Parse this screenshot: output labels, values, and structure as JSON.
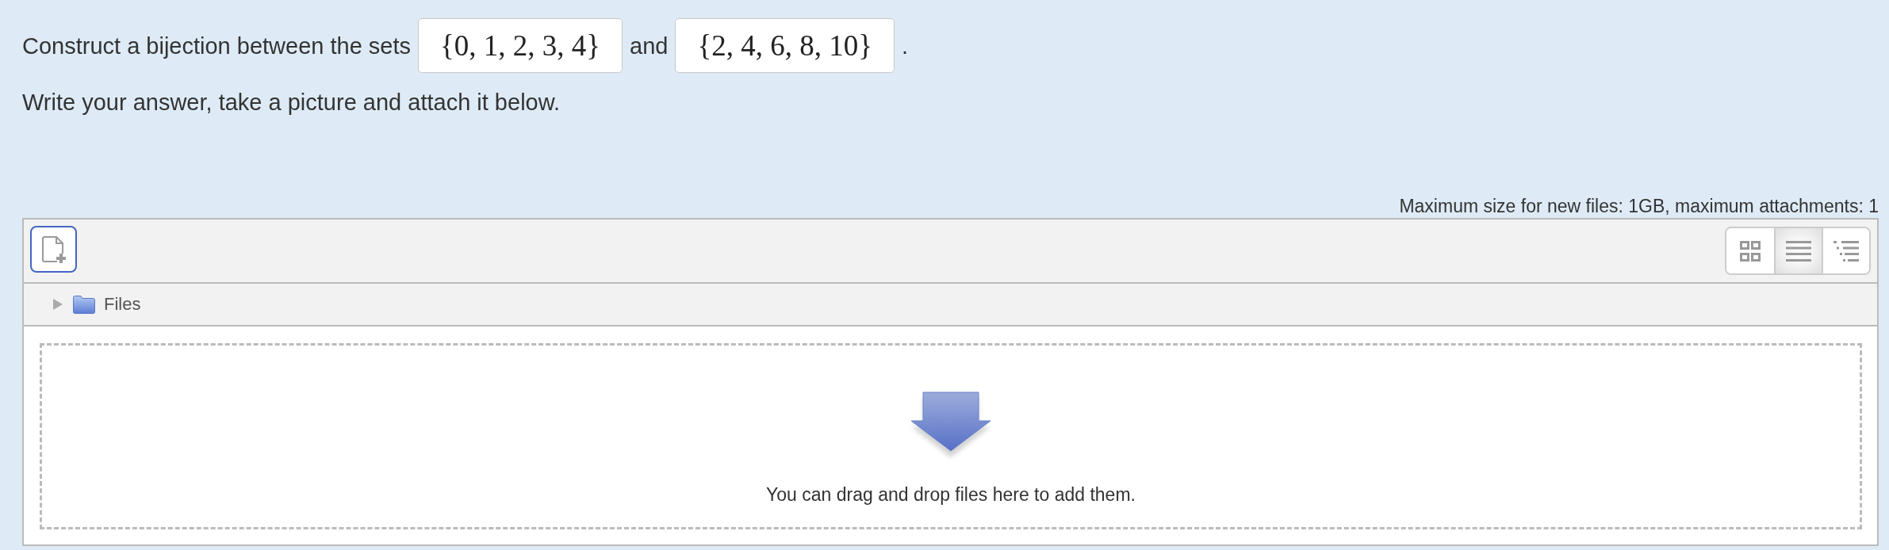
{
  "question": {
    "segments": [
      {
        "kind": "text",
        "text": "Construct a bijection between the sets"
      },
      {
        "kind": "math",
        "text": "{0, 1, 2, 3, 4}"
      },
      {
        "kind": "text",
        "text": "and"
      },
      {
        "kind": "math",
        "text": "{2, 4, 6, 8, 10}"
      },
      {
        "kind": "text",
        "text": "."
      }
    ],
    "instruction": "Write your answer, take a picture and attach it below."
  },
  "file_manager": {
    "limits": "Maximum size for new files: 1GB, maximum attachments: 1",
    "view_buttons": [
      {
        "kind": "icons",
        "selected": false
      },
      {
        "kind": "list",
        "selected": true
      },
      {
        "kind": "tree",
        "selected": false
      }
    ],
    "folders": [
      {
        "label": "Files",
        "expanded": false
      }
    ],
    "drop_hint": "You can drag and drop files here to add them."
  }
}
